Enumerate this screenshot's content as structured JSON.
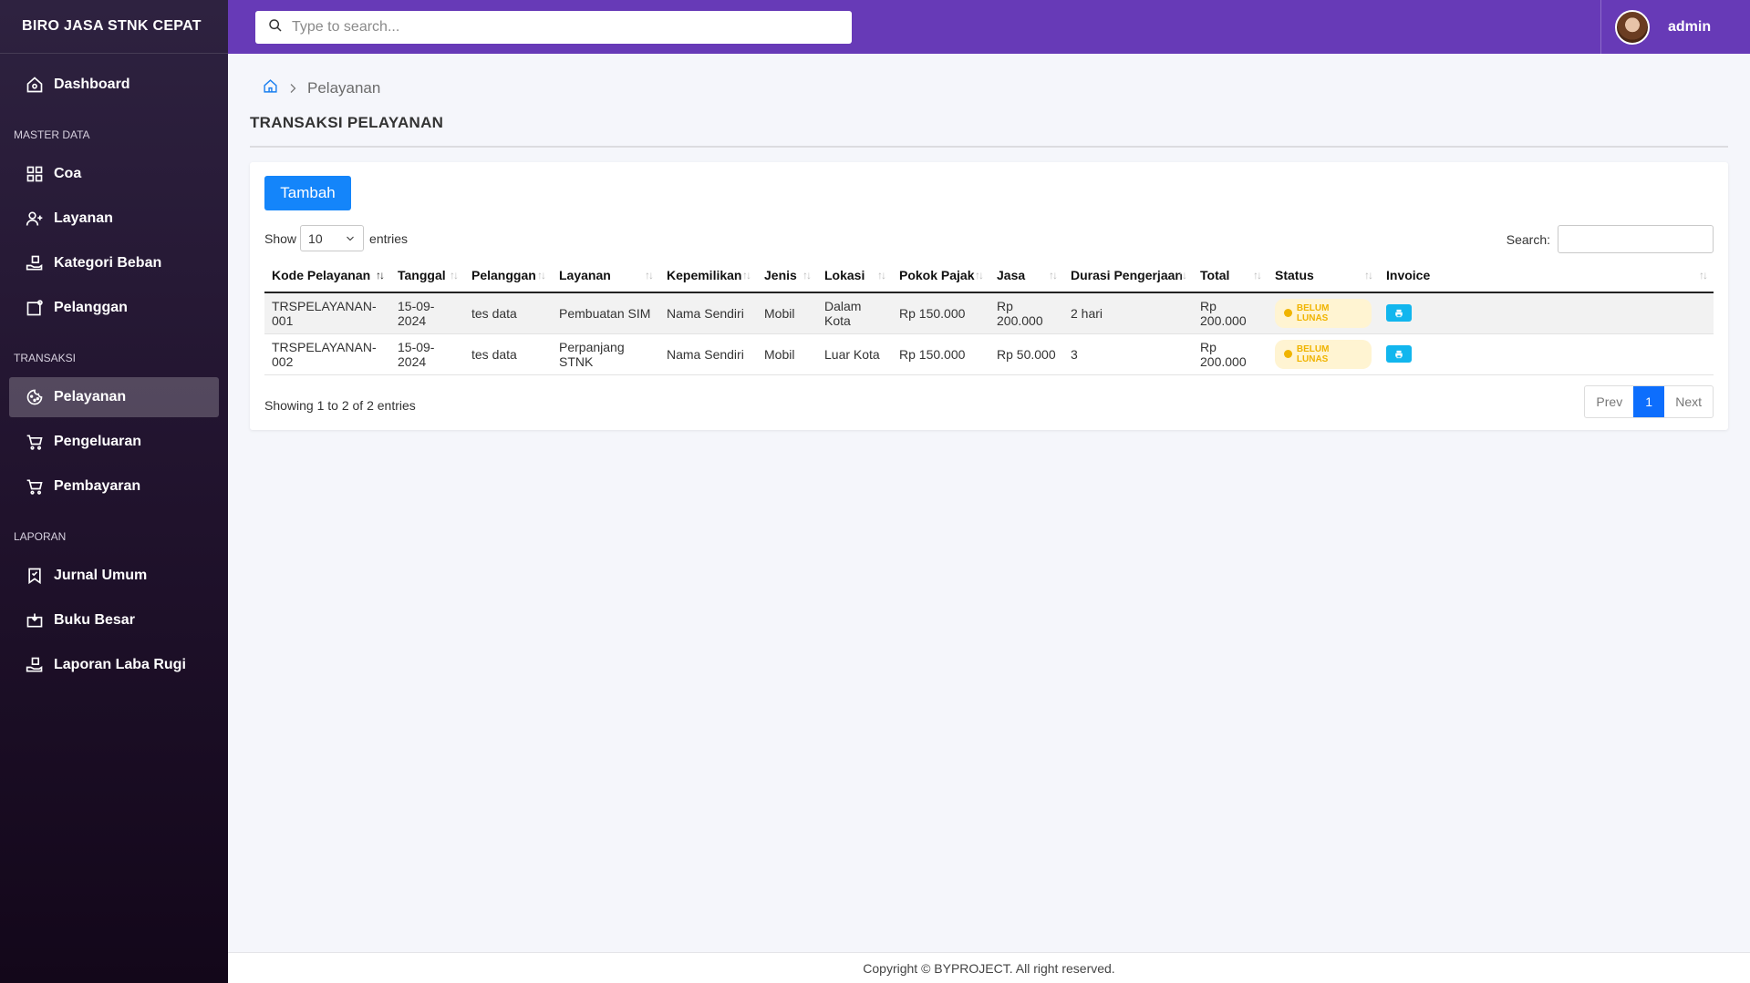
{
  "app": {
    "title": "BIRO JASA STNK CEPAT"
  },
  "sidebar": {
    "dashboard": {
      "label": "Dashboard",
      "icon": "home-icon"
    },
    "sections": [
      {
        "title": "MASTER DATA",
        "items": [
          {
            "label": "Coa",
            "icon": "grid-icon"
          },
          {
            "label": "Layanan",
            "icon": "user-plus-icon"
          },
          {
            "label": "Kategori Beban",
            "icon": "hand-box-icon"
          },
          {
            "label": "Pelanggan",
            "icon": "user-badge-icon"
          }
        ]
      },
      {
        "title": "TRANSAKSI",
        "items": [
          {
            "label": "Pelayanan",
            "icon": "cookie-icon",
            "active": true
          },
          {
            "label": "Pengeluaran",
            "icon": "cart-icon"
          },
          {
            "label": "Pembayaran",
            "icon": "cart-icon"
          }
        ]
      },
      {
        "title": "LAPORAN",
        "items": [
          {
            "label": "Jurnal Umum",
            "icon": "bookmark-icon"
          },
          {
            "label": "Buku Besar",
            "icon": "tray-icon"
          },
          {
            "label": "Laporan Laba Rugi",
            "icon": "hand-box-icon"
          }
        ]
      }
    ]
  },
  "topbar": {
    "search_placeholder": "Type to search...",
    "user_name": "admin"
  },
  "breadcrumb": {
    "current": "Pelayanan"
  },
  "page": {
    "title": "TRANSAKSI PELAYANAN"
  },
  "table_controls": {
    "add_label": "Tambah",
    "show_label": "Show",
    "entries_value": "10",
    "entries_label": "entries",
    "search_label": "Search:"
  },
  "table": {
    "columns": [
      "Kode Pelayanan",
      "Tanggal",
      "Pelanggan",
      "Layanan",
      "Kepemilikan",
      "Jenis",
      "Lokasi",
      "Pokok Pajak",
      "Jasa",
      "Durasi Pengerjaan",
      "Total",
      "Status",
      "Invoice"
    ],
    "rows": [
      [
        "TRSPELAYANAN-001",
        "15-09-2024",
        "tes data",
        "Pembuatan SIM",
        "Nama Sendiri",
        "Mobil",
        "Dalam Kota",
        "Rp 150.000",
        "Rp 200.000",
        "2 hari",
        "Rp 200.000",
        "BELUM LUNAS"
      ],
      [
        "TRSPELAYANAN-002",
        "15-09-2024",
        "tes data",
        "Perpanjang STNK",
        "Nama Sendiri",
        "Mobil",
        "Luar Kota",
        "Rp 150.000",
        "Rp 50.000",
        "3",
        "Rp 200.000",
        "BELUM LUNAS"
      ]
    ]
  },
  "pagination": {
    "info": "Showing 1 to 2 of 2 entries",
    "prev": "Prev",
    "page": "1",
    "next": "Next"
  },
  "footer": {
    "text": "Copyright © BYPROJECT. All right reserved."
  },
  "colors": {
    "topbar": "#673ab7",
    "primary": "#1485fa",
    "badge_warning": "#f0b400",
    "invoice_button": "#12b6ee"
  }
}
